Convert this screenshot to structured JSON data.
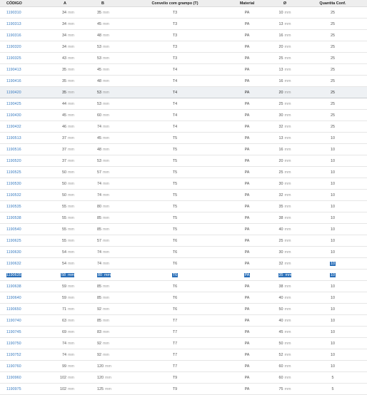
{
  "headers": {
    "code": "CÓDIGO",
    "a": "A",
    "b": "B",
    "conv": "Convelio com grampo (T)",
    "material": "Material",
    "diameter": "Ø",
    "qty": "Quantita Conf."
  },
  "unit": "mm",
  "rows": [
    {
      "code": "1190310",
      "a": "34",
      "b": "35",
      "conv": "T3",
      "mat": "PA",
      "dia": "10",
      "qty": "25"
    },
    {
      "code": "1190313",
      "a": "34",
      "b": "45",
      "conv": "T3",
      "mat": "PA",
      "dia": "13",
      "qty": "25"
    },
    {
      "code": "1190316",
      "a": "34",
      "b": "48",
      "conv": "T3",
      "mat": "PA",
      "dia": "16",
      "qty": "25"
    },
    {
      "code": "1190320",
      "a": "34",
      "b": "53",
      "conv": "T3",
      "mat": "PA",
      "dia": "20",
      "qty": "25"
    },
    {
      "code": "1190325",
      "a": "43",
      "b": "53",
      "conv": "T3",
      "mat": "PA",
      "dia": "25",
      "qty": "25"
    },
    {
      "code": "1190413",
      "a": "35",
      "b": "45",
      "conv": "T4",
      "mat": "PA",
      "dia": "13",
      "qty": "25"
    },
    {
      "code": "1190416",
      "a": "35",
      "b": "48",
      "conv": "T4",
      "mat": "PA",
      "dia": "16",
      "qty": "25"
    },
    {
      "code": "1190420",
      "a": "35",
      "b": "53",
      "conv": "T4",
      "mat": "PA",
      "dia": "20",
      "qty": "25"
    },
    {
      "code": "1190425",
      "a": "44",
      "b": "53",
      "conv": "T4",
      "mat": "PA",
      "dia": "25",
      "qty": "25"
    },
    {
      "code": "1190430",
      "a": "45",
      "b": "60",
      "conv": "T4",
      "mat": "PA",
      "dia": "30",
      "qty": "25"
    },
    {
      "code": "1190432",
      "a": "46",
      "b": "74",
      "conv": "T4",
      "mat": "PA",
      "dia": "32",
      "qty": "25"
    },
    {
      "code": "1190513",
      "a": "37",
      "b": "45",
      "conv": "T5",
      "mat": "PA",
      "dia": "13",
      "qty": "10"
    },
    {
      "code": "1190516",
      "a": "37",
      "b": "48",
      "conv": "T5",
      "mat": "PA",
      "dia": "16",
      "qty": "10"
    },
    {
      "code": "1190520",
      "a": "37",
      "b": "53",
      "conv": "T5",
      "mat": "PA",
      "dia": "20",
      "qty": "10"
    },
    {
      "code": "1190525",
      "a": "50",
      "b": "57",
      "conv": "T5",
      "mat": "PA",
      "dia": "25",
      "qty": "10"
    },
    {
      "code": "1190530",
      "a": "50",
      "b": "74",
      "conv": "T5",
      "mat": "PA",
      "dia": "30",
      "qty": "10"
    },
    {
      "code": "1190532",
      "a": "50",
      "b": "74",
      "conv": "T5",
      "mat": "PA",
      "dia": "32",
      "qty": "10"
    },
    {
      "code": "1190535",
      "a": "55",
      "b": "80",
      "conv": "T5",
      "mat": "PA",
      "dia": "35",
      "qty": "10"
    },
    {
      "code": "1190538",
      "a": "55",
      "b": "85",
      "conv": "T5",
      "mat": "PA",
      "dia": "38",
      "qty": "10"
    },
    {
      "code": "1190540",
      "a": "55",
      "b": "85",
      "conv": "T5",
      "mat": "PA",
      "dia": "40",
      "qty": "10"
    },
    {
      "code": "1190625",
      "a": "55",
      "b": "57",
      "conv": "T6",
      "mat": "PA",
      "dia": "25",
      "qty": "10"
    },
    {
      "code": "1190630",
      "a": "54",
      "b": "74",
      "conv": "T6",
      "mat": "PA",
      "dia": "30",
      "qty": "10"
    },
    {
      "code": "1190632",
      "a": "54",
      "b": "74",
      "conv": "T6",
      "mat": "PA",
      "dia": "32",
      "qty": "10"
    },
    {
      "code": "1190635",
      "a": "58",
      "b": "80",
      "conv": "T6",
      "mat": "PA",
      "dia": "35",
      "qty": "10"
    },
    {
      "code": "1190638",
      "a": "59",
      "b": "85",
      "conv": "T6",
      "mat": "PA",
      "dia": "38",
      "qty": "10"
    },
    {
      "code": "1190640",
      "a": "59",
      "b": "85",
      "conv": "T6",
      "mat": "PA",
      "dia": "40",
      "qty": "10"
    },
    {
      "code": "1190650",
      "a": "71",
      "b": "92",
      "conv": "T6",
      "mat": "PA",
      "dia": "50",
      "qty": "10"
    },
    {
      "code": "1190740",
      "a": "63",
      "b": "85",
      "conv": "T7",
      "mat": "PA",
      "dia": "40",
      "qty": "10"
    },
    {
      "code": "1190745",
      "a": "69",
      "b": "83",
      "conv": "T7",
      "mat": "PA",
      "dia": "45",
      "qty": "10"
    },
    {
      "code": "1190750",
      "a": "74",
      "b": "92",
      "conv": "T7",
      "mat": "PA",
      "dia": "50",
      "qty": "10"
    },
    {
      "code": "1190752",
      "a": "74",
      "b": "92",
      "conv": "T7",
      "mat": "PA",
      "dia": "52",
      "qty": "10"
    },
    {
      "code": "1190760",
      "a": "99",
      "b": "120",
      "conv": "T7",
      "mat": "PA",
      "dia": "60",
      "qty": "10"
    },
    {
      "code": "1190960",
      "a": "102",
      "b": "120",
      "conv": "T9",
      "mat": "PA",
      "dia": "60",
      "qty": "5"
    },
    {
      "code": "1190975",
      "a": "102",
      "b": "125",
      "conv": "T9",
      "mat": "PA",
      "dia": "75",
      "qty": "5"
    }
  ],
  "selected_row_code": "1190420",
  "highlighted_row_code": "1190635",
  "highlighted_qty_row_code": "1190632",
  "colors": {
    "link": "#3a7cc0",
    "highlight": "#2a6fb8",
    "header_bg": "#eeeeee"
  }
}
